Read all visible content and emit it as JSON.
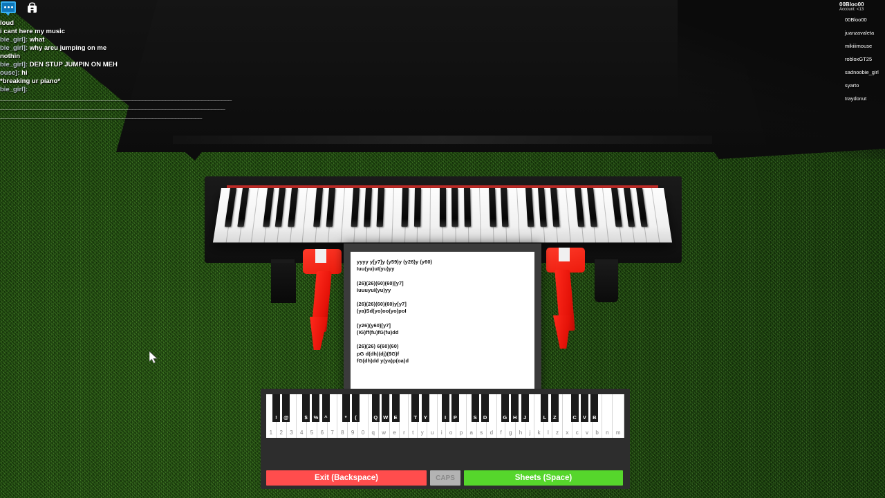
{
  "topbar": {
    "chat_icon": "chat-bubble-icon",
    "backpack_icon": "backpack-icon"
  },
  "chat": {
    "lines": [
      {
        "name": "",
        "name_color": "red",
        "message": "loud"
      },
      {
        "name": "",
        "name_color": "red",
        "message": "i cant here my music"
      },
      {
        "name": "bie_girl]:",
        "name_color": "grey",
        "message": "what"
      },
      {
        "name": "bie_girl]:",
        "name_color": "grey",
        "message": "why areu jumping on me"
      },
      {
        "name": "",
        "name_color": "red",
        "message": "nothin"
      },
      {
        "name": "bie_girl]:",
        "name_color": "grey",
        "message": "DEN STUP JUMPIN ON MEH"
      },
      {
        "name": "ouse]:",
        "name_color": "grey",
        "message": "hi"
      },
      {
        "name": "",
        "name_color": "red",
        "message": "*breaking ur piano*"
      },
      {
        "name": "bie_girl]:",
        "name_color": "grey",
        "message": ""
      }
    ],
    "rules": [
      "______________________________________________________________________",
      "____________________________________________________________________",
      "_____________________________________________________________"
    ]
  },
  "player_list": {
    "local_player": "00Bloo00",
    "account_label": "Account: <13",
    "players": [
      "00Bloo00",
      "juanzavaleta",
      "mikiiimouse",
      "robloxGT25",
      "sadnoobie_girl",
      "syarto",
      "traydonut"
    ]
  },
  "sheet": {
    "text": "yyyy y[y7]y (y59)y (y26)y (y60)\nIuu(yu)uI(yu)yy\n\n(26)(26)(60)(60)[y7]\nIuuuyuI(yu)yy\n\n(26)(26)(60)(60)y[y7]\n(ya)Sd(yo)oo(yo)poI\n\n(y26)(y60)[y7]\n(IG)ff(fu)fG(fu)dd\n\n(26)(26) 6(60)(60)\npG d(dh)(dj)($G)f\nfG(dh)dd y(ya)p(oa)d"
  },
  "piano_ui": {
    "white_keys": [
      "1",
      "2",
      "3",
      "4",
      "5",
      "6",
      "7",
      "8",
      "9",
      "0",
      "q",
      "w",
      "e",
      "r",
      "t",
      "y",
      "u",
      "i",
      "o",
      "p",
      "a",
      "s",
      "d",
      "f",
      "g",
      "h",
      "j",
      "k",
      "l",
      "z",
      "x",
      "c",
      "v",
      "b",
      "n",
      "m"
    ],
    "black_keys": [
      {
        "label": "!",
        "after": 0
      },
      {
        "label": "@",
        "after": 1
      },
      {
        "label": "$",
        "after": 3
      },
      {
        "label": "%",
        "after": 4
      },
      {
        "label": "^",
        "after": 5
      },
      {
        "label": "*",
        "after": 7
      },
      {
        "label": "(",
        "after": 8
      },
      {
        "label": "Q",
        "after": 10
      },
      {
        "label": "W",
        "after": 11
      },
      {
        "label": "E",
        "after": 12
      },
      {
        "label": "T",
        "after": 14
      },
      {
        "label": "Y",
        "after": 15
      },
      {
        "label": "I",
        "after": 17
      },
      {
        "label": "P",
        "after": 18
      },
      {
        "label": "S",
        "after": 20
      },
      {
        "label": "D",
        "after": 21
      },
      {
        "label": "G",
        "after": 23
      },
      {
        "label": "H",
        "after": 24
      },
      {
        "label": "J",
        "after": 25
      },
      {
        "label": "L",
        "after": 27
      },
      {
        "label": "Z",
        "after": 28
      },
      {
        "label": "C",
        "after": 30
      },
      {
        "label": "V",
        "after": 31
      },
      {
        "label": "B",
        "after": 32
      }
    ],
    "buttons": {
      "exit": "Exit (Backspace)",
      "caps": "CAPS",
      "sheets": "Sheets (Space)"
    }
  },
  "colors": {
    "exit_red": "#ff4d4d",
    "sheets_green": "#56d62c",
    "caps_grey": "#b3b3b3",
    "grass_green": "#255c10",
    "arm_red": "#e41208",
    "piano_black": "#0d0d0d",
    "felt_red": "#c32a26"
  }
}
